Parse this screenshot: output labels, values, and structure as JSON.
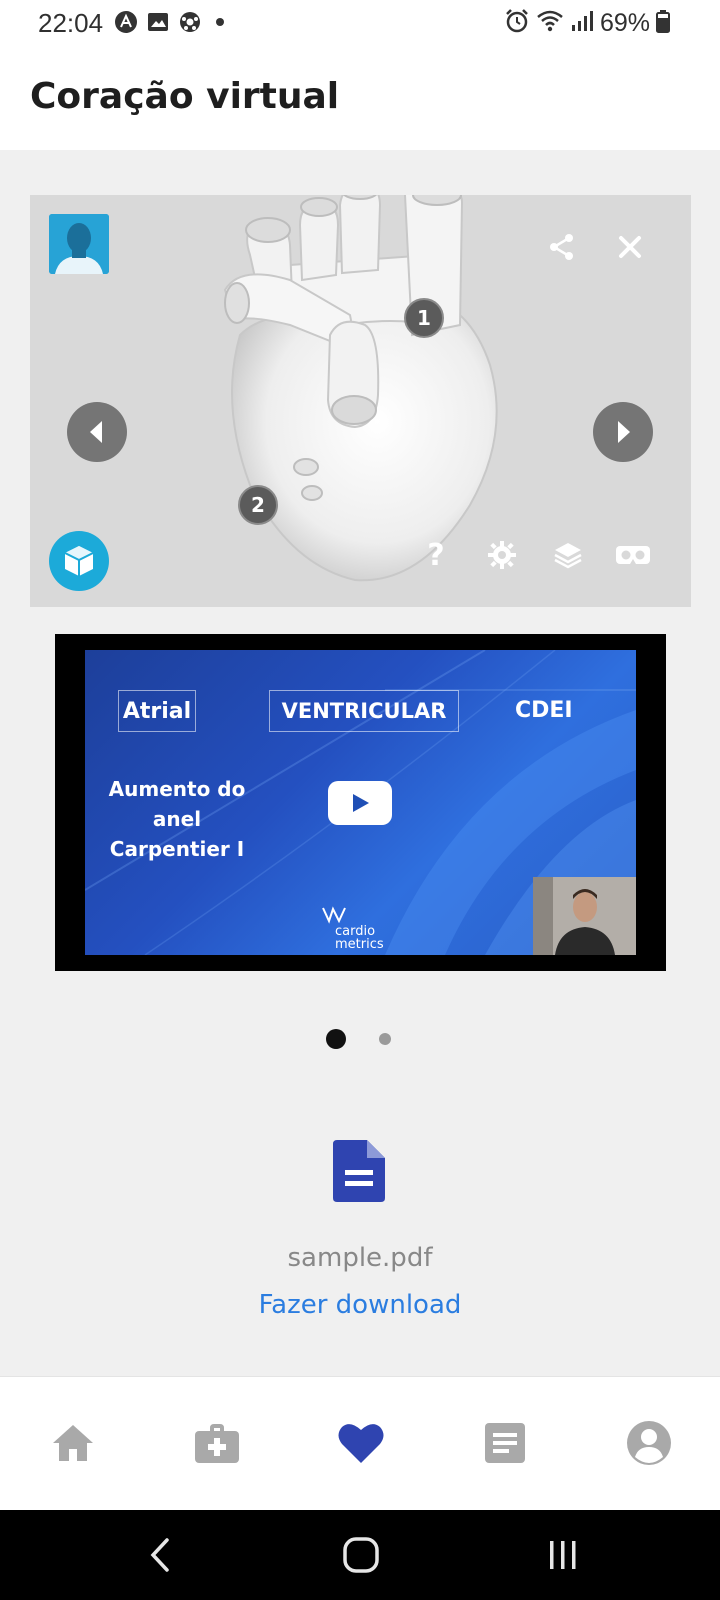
{
  "status_bar": {
    "time": "22:04",
    "battery": "69%",
    "left_icons": [
      "a-badge-icon",
      "image-icon",
      "soccer-ball-icon",
      "dot-icon"
    ],
    "right_icons": [
      "alarm-icon",
      "wifi-icon",
      "signal-icon",
      "battery-icon"
    ]
  },
  "header": {
    "title": "Coração virtual"
  },
  "viewer": {
    "hotspot_1": "1",
    "hotspot_2": "2",
    "icons": [
      "share-icon",
      "close-icon",
      "prev-arrow-icon",
      "next-arrow-icon",
      "help-icon",
      "settings-icon",
      "layers-icon",
      "vr-headset-icon",
      "sketchfab-logo-icon"
    ]
  },
  "video": {
    "tab_atrial": "Atrial",
    "tab_ventricular": "VENTRICULAR",
    "tab_cdei": "CDEI",
    "caption_line_1": "Aumento do",
    "caption_line_2": "anel",
    "caption_line_3": "Carpentier I",
    "logo_line_1": "cardio",
    "logo_line_2": "metrics"
  },
  "pager": {
    "count": 2,
    "active_index": 0
  },
  "attachment": {
    "filename": "sample.pdf",
    "download_label": "Fazer download",
    "accent_color": "#2b7de0",
    "icon_color": "#2f44b0"
  },
  "bottom_nav": {
    "items": [
      "home-icon",
      "medical-kit-icon",
      "heart-icon",
      "document-icon",
      "profile-icon"
    ],
    "active_index": 2,
    "active_color": "#2f44b0",
    "inactive_color": "#a9a9a9"
  }
}
